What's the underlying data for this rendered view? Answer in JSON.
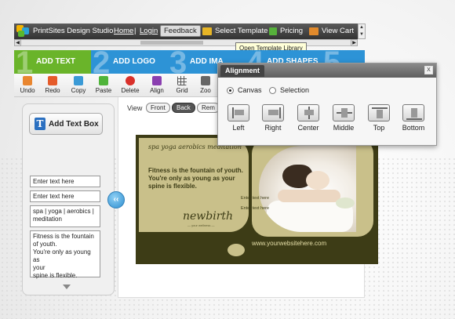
{
  "header": {
    "brand": "PrintSites Design Studio",
    "home": "Home",
    "sep": "|",
    "login": "Login",
    "feedback": "Feedback",
    "select_template": "Select Template",
    "pricing": "Pricing",
    "view_cart": "View Cart",
    "tooltip": "Open Template Library"
  },
  "steps": [
    {
      "num": "1",
      "label": "ADD TEXT",
      "color": "#6ab42a"
    },
    {
      "num": "2",
      "label": "ADD LOGO",
      "color": "#2d93d6"
    },
    {
      "num": "3",
      "label": "ADD IMA",
      "color": "#2d93d6"
    },
    {
      "num": "4",
      "label": "ADD SHAPES",
      "color": "#2d93d6"
    },
    {
      "num": "5",
      "label": "",
      "color": "#2d93d6"
    }
  ],
  "toolbar": {
    "undo": "Undo",
    "redo": "Redo",
    "copy": "Copy",
    "paste": "Paste",
    "delete": "Delete",
    "align": "Align",
    "grid": "Grid",
    "zoom": "Zoo"
  },
  "left": {
    "add_text": "Add Text Box",
    "fields": [
      "Enter text here",
      "Enter text here",
      "spa | yoga | aerobics |\nmeditation",
      "Fitness is the  fountain\nof youth.\nYou're only as young as\nyour\nspine is flexible."
    ]
  },
  "view": {
    "label": "View",
    "front": "Front",
    "back": "Back",
    "rem": "Rem"
  },
  "card": {
    "tagline": "spa  yoga  aerobics  meditation",
    "body": "Fitness is the  fountain of youth.\nYou're only as young as your\nspine is flexible.",
    "brand": "newbirth",
    "brand_sub": "—  your wellness  —",
    "small1": "Enter text here",
    "small2": "Enter text here",
    "url": "www.yourwebsitehere.com"
  },
  "alignment": {
    "title": "Alignment",
    "close": "X",
    "canvas": "Canvas",
    "selection": "Selection",
    "buttons": [
      "Left",
      "Right",
      "Center",
      "Middle",
      "Top",
      "Bottom"
    ]
  }
}
